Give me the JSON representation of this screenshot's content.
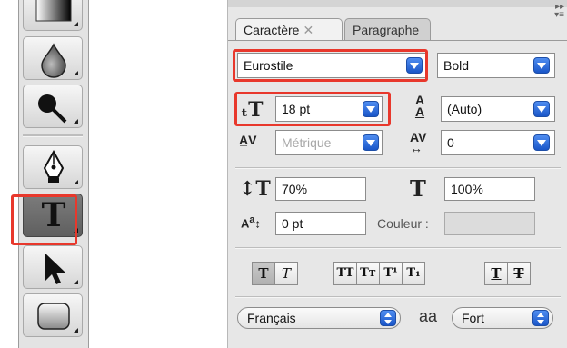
{
  "toolbox": {
    "tools": [
      {
        "name": "gradient-tool-icon",
        "selected": false
      },
      {
        "name": "blur-tool-icon",
        "selected": false
      },
      {
        "name": "dodge-tool-icon",
        "selected": false
      },
      {
        "name": "pen-tool-icon",
        "selected": false
      },
      {
        "name": "type-tool-icon",
        "selected": true
      },
      {
        "name": "path-selection-tool-icon",
        "selected": false
      },
      {
        "name": "rectangle-tool-icon",
        "selected": false
      }
    ],
    "type_glyph": "T"
  },
  "panel": {
    "tabs": {
      "active": "Caractère",
      "inactive": "Paragraphe",
      "close": "✕"
    },
    "font_family": "Eurostile",
    "font_style": "Bold",
    "font_size": "18 pt",
    "leading": "(Auto)",
    "kerning": "Métrique",
    "tracking": "0",
    "vertical_scale": "70%",
    "horizontal_scale": "100%",
    "baseline_shift": "0 pt",
    "color_label": "Couleur :",
    "format_buttons": [
      [
        "T",
        "T"
      ],
      [
        "TT",
        "Tт",
        "T¹",
        "T₁"
      ],
      [
        "T",
        "T"
      ]
    ],
    "language": "Français",
    "antialias_icon_text": "aa",
    "antialias": "Fort"
  },
  "highlight_color": "#e8382c",
  "accent_blue": "#2a63d6"
}
